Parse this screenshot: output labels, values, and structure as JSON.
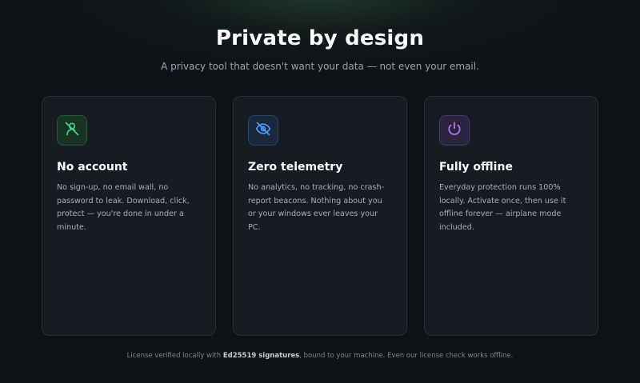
{
  "hero": {
    "title": "Private by design",
    "subtitle": "A privacy tool that doesn't want your data — not even your email."
  },
  "cards": [
    {
      "icon": "user-off-icon",
      "accent": "#3ddc84",
      "title": "No account",
      "body": "No sign-up, no email wall, no password to leak. Download, click, protect — you're done in under a minute."
    },
    {
      "icon": "eye-off-icon",
      "accent": "#4a9eff",
      "title": "Zero telemetry",
      "body": "No analytics, no tracking, no crash-report beacons. Nothing about you or your windows ever leaves your PC."
    },
    {
      "icon": "power-icon",
      "accent": "#b083f0",
      "title": "Fully offline",
      "body": "Everyday protection runs 100% locally. Activate once, then use it offline forever — airplane mode included."
    }
  ],
  "footer": {
    "prefix": "License verified locally with ",
    "highlight": "Ed25519 signatures",
    "suffix": ", bound to your machine. Even our license check works offline."
  }
}
